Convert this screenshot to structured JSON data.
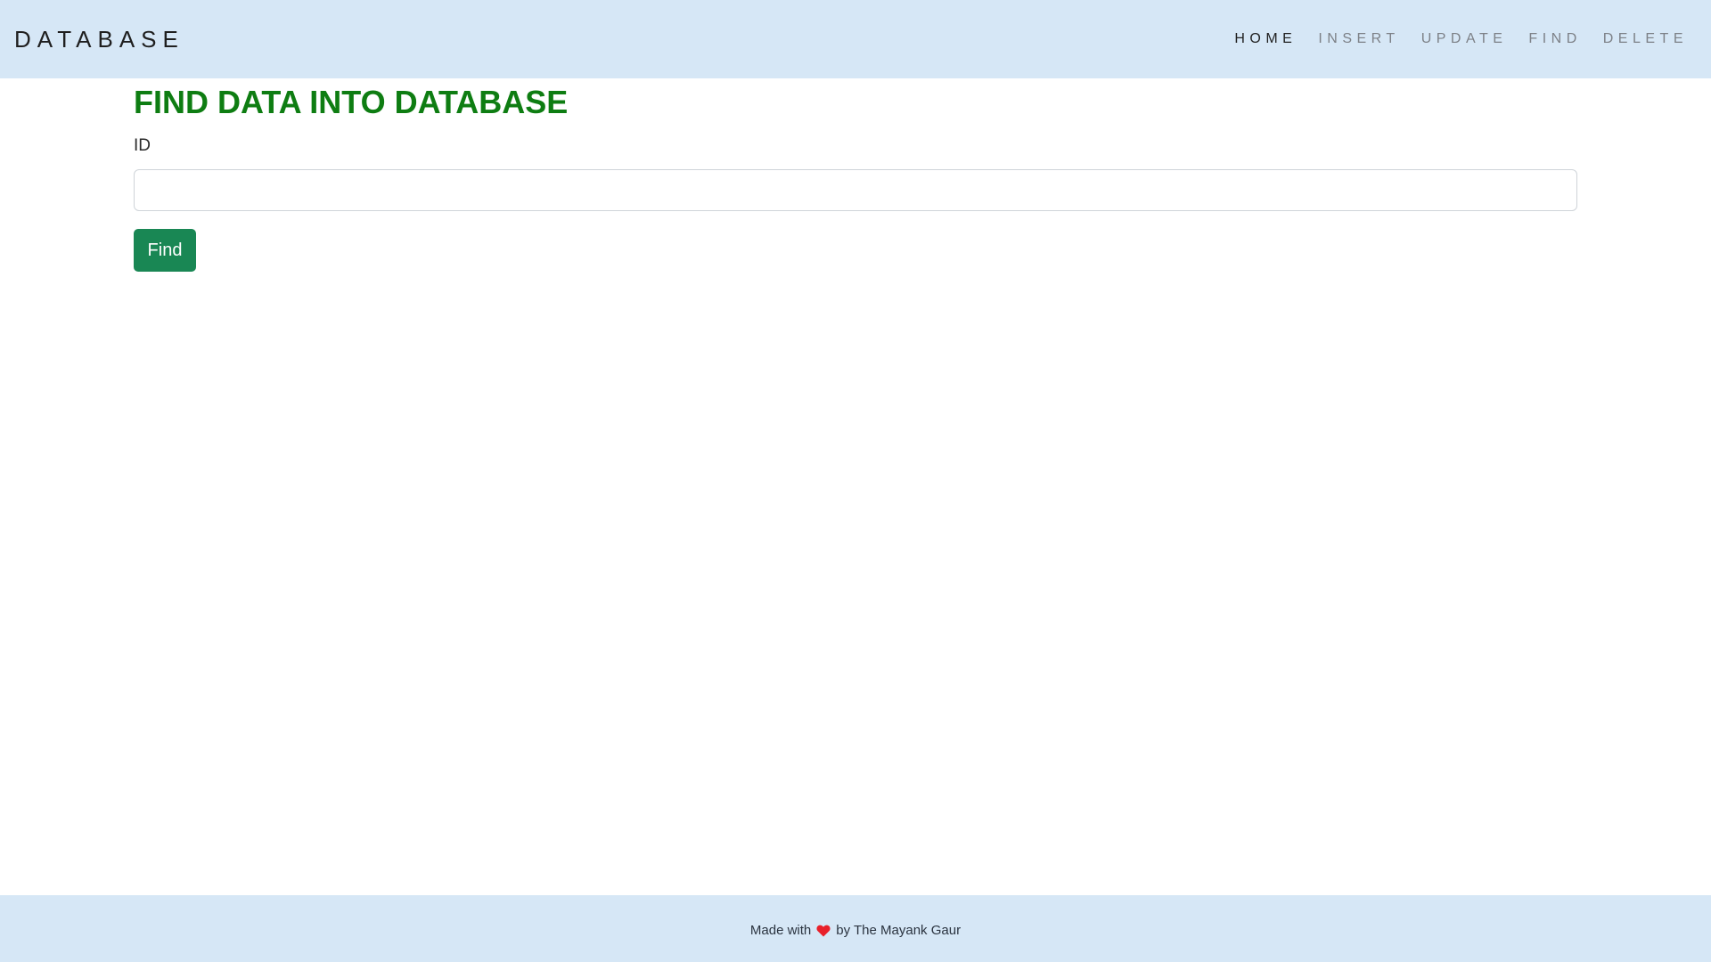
{
  "navbar": {
    "brand": "DATABASE",
    "links": [
      {
        "label": "HOME",
        "active": true
      },
      {
        "label": "INSERT",
        "active": false
      },
      {
        "label": "UPDATE",
        "active": false
      },
      {
        "label": "FIND",
        "active": false
      },
      {
        "label": "DELETE",
        "active": false
      }
    ]
  },
  "main": {
    "title": "FIND DATA INTO DATABASE",
    "id_label": "ID",
    "id_value": "",
    "id_placeholder": "",
    "find_label": "Find"
  },
  "footer": {
    "prefix": "Made with",
    "icon": "heart-icon",
    "suffix": "by The Mayank Gaur"
  },
  "colors": {
    "header_bg": "#d6e7f6",
    "title": "#0e7d12",
    "button": "#198754",
    "heart": "#e8202a"
  }
}
